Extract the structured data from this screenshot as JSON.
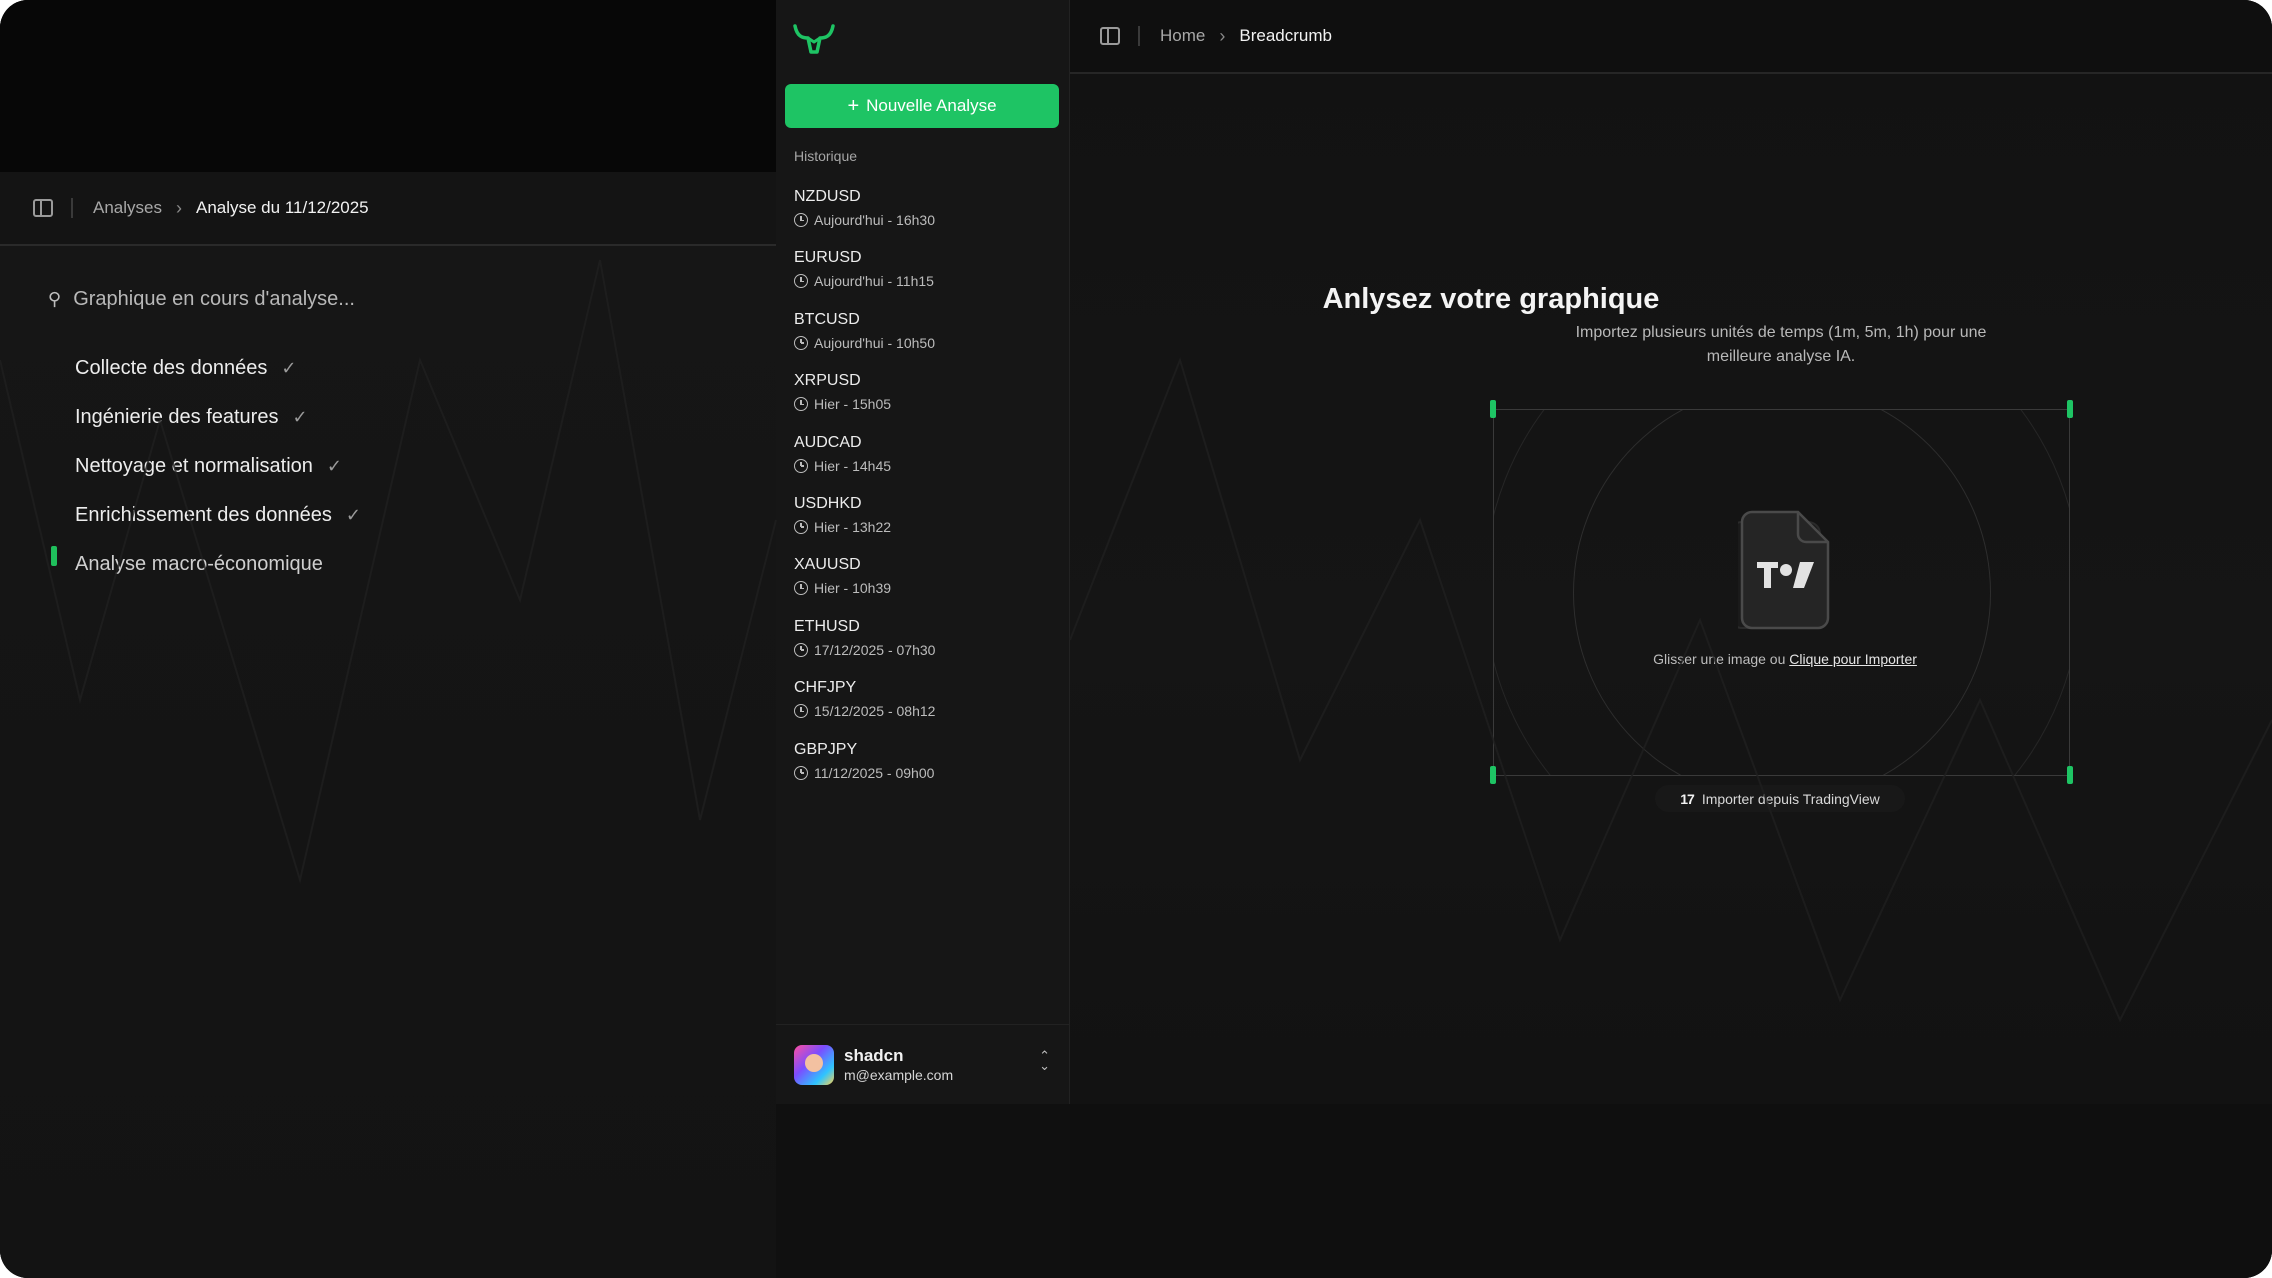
{
  "analysis_panel": {
    "breadcrumb": {
      "parent": "Analyses",
      "current": "Analyse du 11/12/2025"
    },
    "progress_title": "Graphique en cours d'analyse...",
    "steps": [
      {
        "label": "Collecte des données",
        "done": true
      },
      {
        "label": "Ingénierie des features",
        "done": true
      },
      {
        "label": "Nettoyage et normalisation",
        "done": true
      },
      {
        "label": "Enrichissement des données",
        "done": true
      },
      {
        "label": "Analyse macro-économique",
        "done": false
      }
    ],
    "check_glyph": "✓"
  },
  "sidebar": {
    "new_button_label": "Nouvelle Analyse",
    "history_label": "Historique",
    "history": [
      {
        "pair": "NZDUSD",
        "time": "Aujourd'hui - 16h30"
      },
      {
        "pair": "EURUSD",
        "time": "Aujourd'hui - 11h15"
      },
      {
        "pair": "BTCUSD",
        "time": "Aujourd'hui - 10h50"
      },
      {
        "pair": "XRPUSD",
        "time": "Hier - 15h05"
      },
      {
        "pair": "AUDCAD",
        "time": "Hier - 14h45"
      },
      {
        "pair": "USDHKD",
        "time": "Hier - 13h22"
      },
      {
        "pair": "XAUUSD",
        "time": "Hier - 10h39"
      },
      {
        "pair": "ETHUSD",
        "time": "17/12/2025 - 07h30"
      },
      {
        "pair": "CHFJPY",
        "time": "15/12/2025 - 08h12"
      },
      {
        "pair": "GBPJPY",
        "time": "11/12/2025 - 09h00"
      }
    ],
    "user": {
      "name": "shadcn",
      "email": "m@example.com"
    }
  },
  "main": {
    "breadcrumb": {
      "home": "Home",
      "current": "Breadcrumb"
    },
    "title": "Anlysez votre graphique",
    "subtitle": "Importez plusieurs unités de temps (1m, 5m, 1h) pour une meilleure analyse IA.",
    "drop_text": "Glisser une image ou",
    "drop_link": "Clique pour Importer",
    "tradingview_button": "Importer depuis TradingView",
    "tv_logo_text": "17"
  },
  "colors": {
    "accent": "#1ec464",
    "background": "#121212",
    "sidebar": "#161616"
  },
  "icons": [
    "sidebar-toggle-icon",
    "chevron-right-icon",
    "search-icon",
    "check-icon",
    "plus-icon",
    "clock-icon",
    "chevrons-up-down-icon",
    "file-icon",
    "tradingview-icon",
    "bull-logo-icon"
  ]
}
